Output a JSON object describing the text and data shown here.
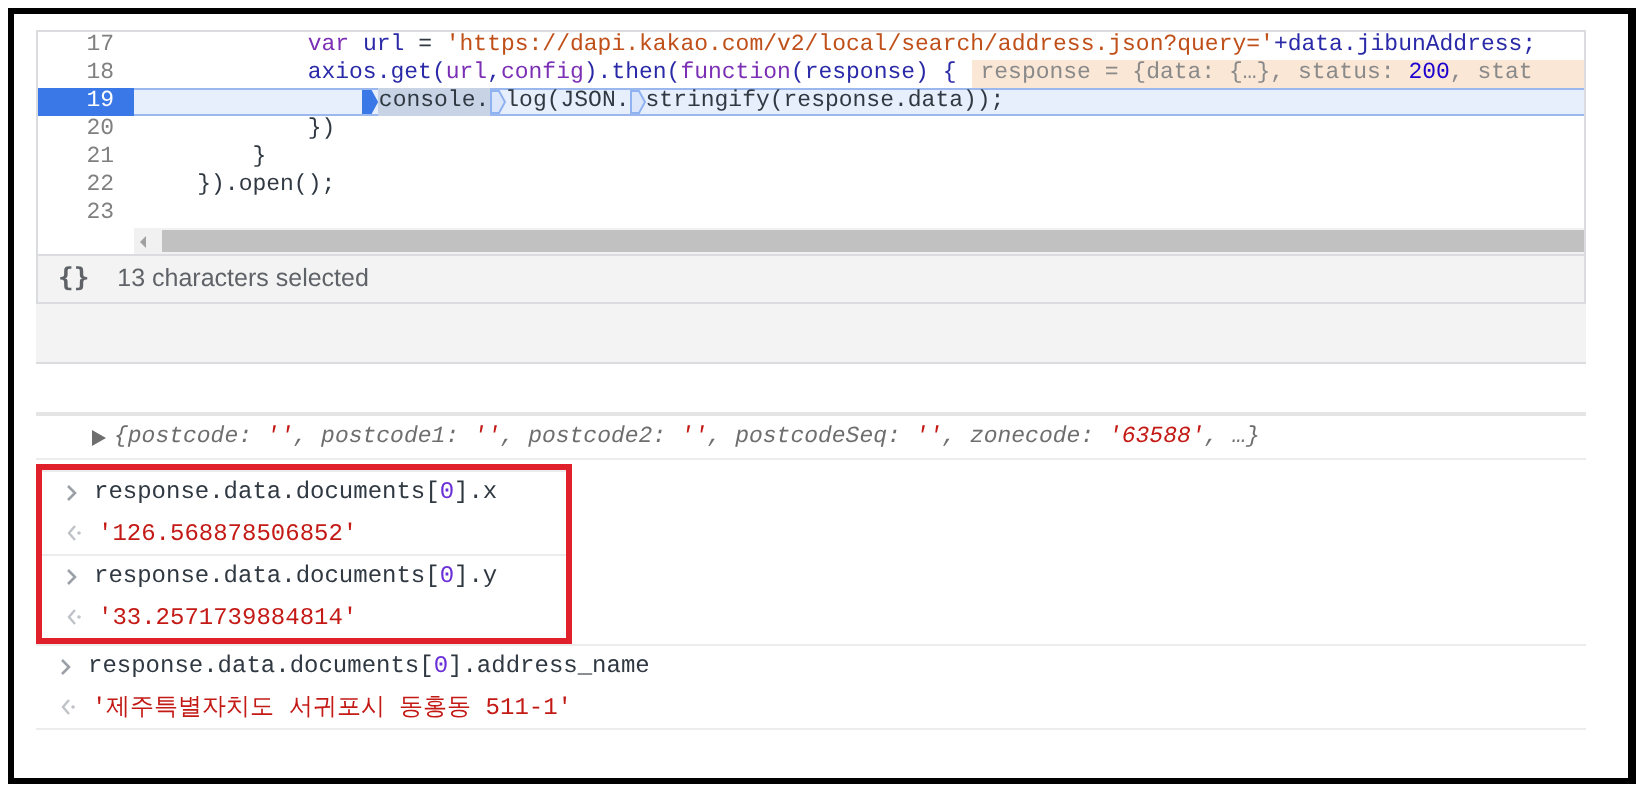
{
  "editor": {
    "lines": [
      {
        "number": "17",
        "current": false,
        "tokens": [
          {
            "kind": "kw",
            "text": "            var "
          },
          {
            "kind": "var",
            "text": "url"
          },
          {
            "kind": "plain",
            "text": " = "
          },
          {
            "kind": "str",
            "text": "'https://dapi.kakao.com/v2/local/search/address.json?query='"
          },
          {
            "kind": "var",
            "text": "+data.jibunAddress;"
          }
        ]
      },
      {
        "number": "18",
        "current": false,
        "tokens": [
          {
            "kind": "var",
            "text": "            axios.get("
          },
          {
            "kind": "kw",
            "text": "url"
          },
          {
            "kind": "var",
            "text": ","
          },
          {
            "kind": "kw",
            "text": "config"
          },
          {
            "kind": "var",
            "text": ").then("
          },
          {
            "kind": "kw",
            "text": "function"
          },
          {
            "kind": "var",
            "text": "(response) {"
          }
        ],
        "hint": [
          {
            "kind": "hint",
            "text": "response = {data: {…}, status: "
          },
          {
            "kind": "num",
            "text": "200"
          },
          {
            "kind": "hint",
            "text": ", stat"
          }
        ]
      },
      {
        "number": "19",
        "current": true,
        "tokens": [
          {
            "kind": "plain",
            "text": "                console.",
            "selected": true,
            "breakpoint": true,
            "active": true
          },
          {
            "kind": "plain",
            "text": "log(JSON.",
            "breakpoint": true,
            "active": false
          },
          {
            "kind": "plain",
            "text": "stringify(response.data));",
            "breakpoint": true,
            "active": false
          }
        ]
      },
      {
        "number": "20",
        "current": false,
        "tokens": [
          {
            "kind": "plain",
            "text": "            })"
          }
        ]
      },
      {
        "number": "21",
        "current": false,
        "tokens": [
          {
            "kind": "plain",
            "text": "        }"
          }
        ]
      },
      {
        "number": "22",
        "current": false,
        "tokens": [
          {
            "kind": "plain",
            "text": "    }).open();"
          }
        ]
      },
      {
        "number": "23",
        "current": false
      }
    ]
  },
  "status_bar": {
    "format_button": "{}",
    "text": "13 characters selected"
  },
  "console": {
    "object_preview": [
      {
        "kind": "key",
        "text": "{postcode: "
      },
      {
        "kind": "str",
        "text": "''"
      },
      {
        "kind": "key",
        "text": ", postcode1: "
      },
      {
        "kind": "str",
        "text": "''"
      },
      {
        "kind": "key",
        "text": ", postcode2: "
      },
      {
        "kind": "str",
        "text": "''"
      },
      {
        "kind": "key",
        "text": ", postcodeSeq: "
      },
      {
        "kind": "str",
        "text": "''"
      },
      {
        "kind": "key",
        "text": ", zonecode: "
      },
      {
        "kind": "str",
        "text": "'63588'"
      },
      {
        "kind": "key",
        "text": ", …}"
      }
    ],
    "entries": [
      {
        "kind": "input",
        "boxed": true,
        "tokens": [
          {
            "kind": "plain",
            "text": "response.data.documents["
          },
          {
            "kind": "num",
            "text": "0"
          },
          {
            "kind": "plain",
            "text": "].x"
          }
        ]
      },
      {
        "kind": "output",
        "boxed": true,
        "tokens": [
          {
            "kind": "str",
            "text": "'126.568878506852'"
          }
        ]
      },
      {
        "kind": "input",
        "boxed": true,
        "tokens": [
          {
            "kind": "plain",
            "text": "response.data.documents["
          },
          {
            "kind": "num",
            "text": "0"
          },
          {
            "kind": "plain",
            "text": "].y"
          }
        ]
      },
      {
        "kind": "output",
        "boxed": true,
        "tokens": [
          {
            "kind": "str",
            "text": "'33.2571739884814'"
          }
        ]
      },
      {
        "kind": "input",
        "boxed": false,
        "tokens": [
          {
            "kind": "plain",
            "text": "response.data.documents["
          },
          {
            "kind": "num",
            "text": "0"
          },
          {
            "kind": "plain",
            "text": "].address_name"
          }
        ]
      },
      {
        "kind": "output",
        "boxed": false,
        "tokens": [
          {
            "kind": "str",
            "text": "'제주특별자치도 서귀포시 동홍동 511-1'"
          }
        ]
      }
    ]
  }
}
